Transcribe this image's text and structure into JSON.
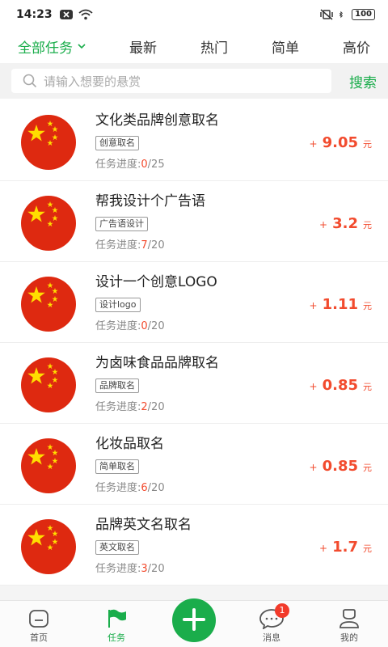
{
  "status_bar": {
    "time": "14:23",
    "battery": "100"
  },
  "tabs": [
    {
      "label": "全部任务",
      "active": true
    },
    {
      "label": "最新",
      "active": false
    },
    {
      "label": "热门",
      "active": false
    },
    {
      "label": "简单",
      "active": false
    },
    {
      "label": "高价",
      "active": false
    }
  ],
  "search": {
    "placeholder": "请输入想要的悬赏",
    "button": "搜索"
  },
  "tasks": [
    {
      "title": "文化类品牌创意取名",
      "tag": "创意取名",
      "progress_label": "任务进度:",
      "done": "0",
      "total": "/25",
      "plus": "+",
      "amount": "9.05",
      "unit": "元"
    },
    {
      "title": "帮我设计个广告语",
      "tag": "广告语设计",
      "progress_label": "任务进度:",
      "done": "7",
      "total": "/20",
      "plus": "+",
      "amount": "3.2",
      "unit": "元"
    },
    {
      "title": "设计一个创意LOGO",
      "tag": "设计logo",
      "progress_label": "任务进度:",
      "done": "0",
      "total": "/20",
      "plus": "+",
      "amount": "1.11",
      "unit": "元"
    },
    {
      "title": "为卤味食品品牌取名",
      "tag": "品牌取名",
      "progress_label": "任务进度:",
      "done": "2",
      "total": "/20",
      "plus": "+",
      "amount": "0.85",
      "unit": "元"
    },
    {
      "title": "化妆品取名",
      "tag": "简单取名",
      "progress_label": "任务进度:",
      "done": "6",
      "total": "/20",
      "plus": "+",
      "amount": "0.85",
      "unit": "元"
    },
    {
      "title": "品牌英文名取名",
      "tag": "英文取名",
      "progress_label": "任务进度:",
      "done": "3",
      "total": "/20",
      "plus": "+",
      "amount": "1.7",
      "unit": "元"
    }
  ],
  "bottom_nav": [
    {
      "label": "首页",
      "icon": "home-icon"
    },
    {
      "label": "任务",
      "icon": "flag-icon",
      "active": true
    },
    {
      "label": "",
      "icon": "plus-icon"
    },
    {
      "label": "消息",
      "icon": "chat-icon",
      "badge": "1"
    },
    {
      "label": "我的",
      "icon": "user-icon"
    }
  ],
  "colors": {
    "accent": "#1aad4b",
    "price": "#f24b2e",
    "badge": "#f23a2a"
  }
}
